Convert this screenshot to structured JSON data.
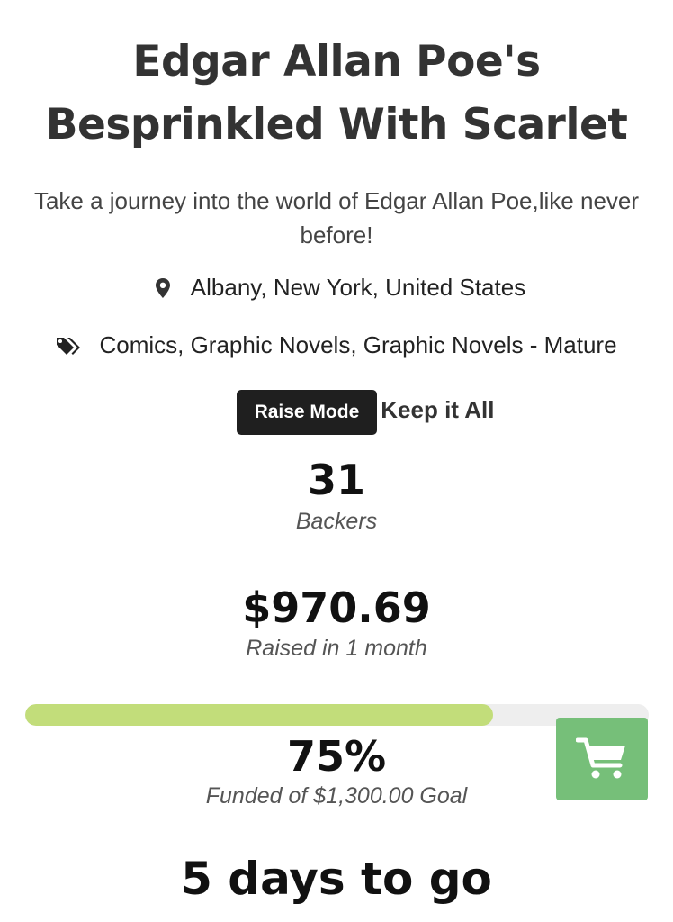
{
  "campaign": {
    "title_line1": "Edgar Allan Poe's",
    "title_line2": "Besprinkled With Scarlet",
    "subtitle": "Take a journey into the world of Edgar Allan Poe,like never before!",
    "location": "Albany, New York, United States",
    "categories": "Comics, Graphic Novels, Graphic Novels - Mature",
    "raise_mode_label": "Raise Mode",
    "raise_mode_value": "Keep it All"
  },
  "stats": {
    "backers_count": "31",
    "backers_label": "Backers",
    "raised_amount": "$970.69",
    "raised_label": "Raised in 1 month",
    "funded_percent": "75%",
    "funded_fraction": 0.75,
    "funded_label": "Funded of $1,300.00 Goal",
    "days_left": "5 days to go"
  },
  "icons": {
    "location": "map-pin-icon",
    "categories": "tags-icon",
    "cart": "shopping-cart-icon"
  },
  "colors": {
    "progress_fill": "#c2dd7a",
    "progress_track": "#eeeeee",
    "cart_button": "#76bf79",
    "badge": "#1f1f1f"
  }
}
